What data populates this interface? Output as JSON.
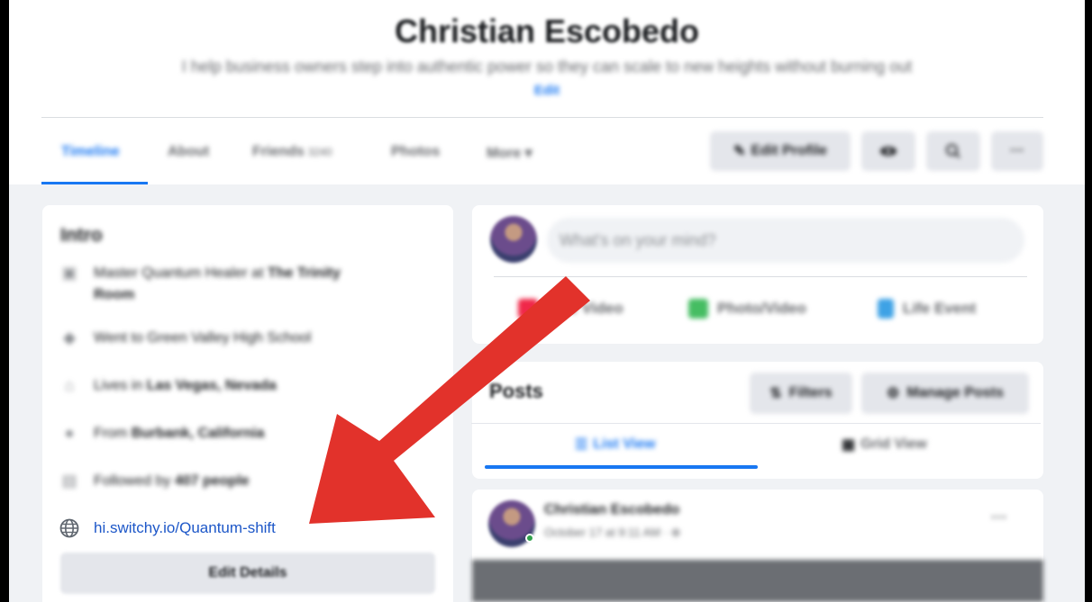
{
  "profile": {
    "name": "Christian Escobedo",
    "bio": "I help business owners step into authentic power so they can scale to new heights without burning out",
    "bio_edit_label": "Edit"
  },
  "tabs": [
    {
      "label": "Timeline",
      "active": true
    },
    {
      "label": "About"
    },
    {
      "label": "Friends",
      "count": "3240"
    },
    {
      "label": "Photos"
    },
    {
      "label": "More ▾"
    }
  ],
  "header_actions": {
    "edit_profile_label": "Edit Profile",
    "view_as_icon": "eye-icon",
    "search_icon": "search-icon",
    "more_label": "···"
  },
  "intro": {
    "title": "Intro",
    "items": [
      {
        "icon": "briefcase-icon",
        "text": "Master Quantum Healer at ",
        "bold": "The Trinity Room"
      },
      {
        "icon": "graduation-cap-icon",
        "text": "Went to Green Valley High School",
        "bold": ""
      },
      {
        "icon": "home-icon",
        "text": "Lives in ",
        "bold": "Las Vegas, Nevada"
      },
      {
        "icon": "location-pin-icon",
        "text": "From ",
        "bold": "Burbank, California"
      },
      {
        "icon": "followers-icon",
        "text": "Followed by ",
        "bold": "407 people"
      }
    ],
    "website": "hi.switchy.io/Quantum-shift",
    "edit_details_label": "Edit Details"
  },
  "composer": {
    "placeholder": "What's on your mind?",
    "live_video_label": "Live Video",
    "photo_video_label": "Photo/Video",
    "life_event_label": "Life Event"
  },
  "posts": {
    "title": "Posts",
    "filters_label": "Filters",
    "manage_label": "Manage Posts",
    "list_view_label": "List View",
    "grid_view_label": "Grid View"
  },
  "post": {
    "author": "Christian Escobedo",
    "meta": "October 17 at 9:11 AM · ⊕",
    "more_label": "···"
  },
  "colors": {
    "accent": "#1877f2",
    "link": "#1d57c8",
    "annotation_arrow": "#e2322b"
  }
}
